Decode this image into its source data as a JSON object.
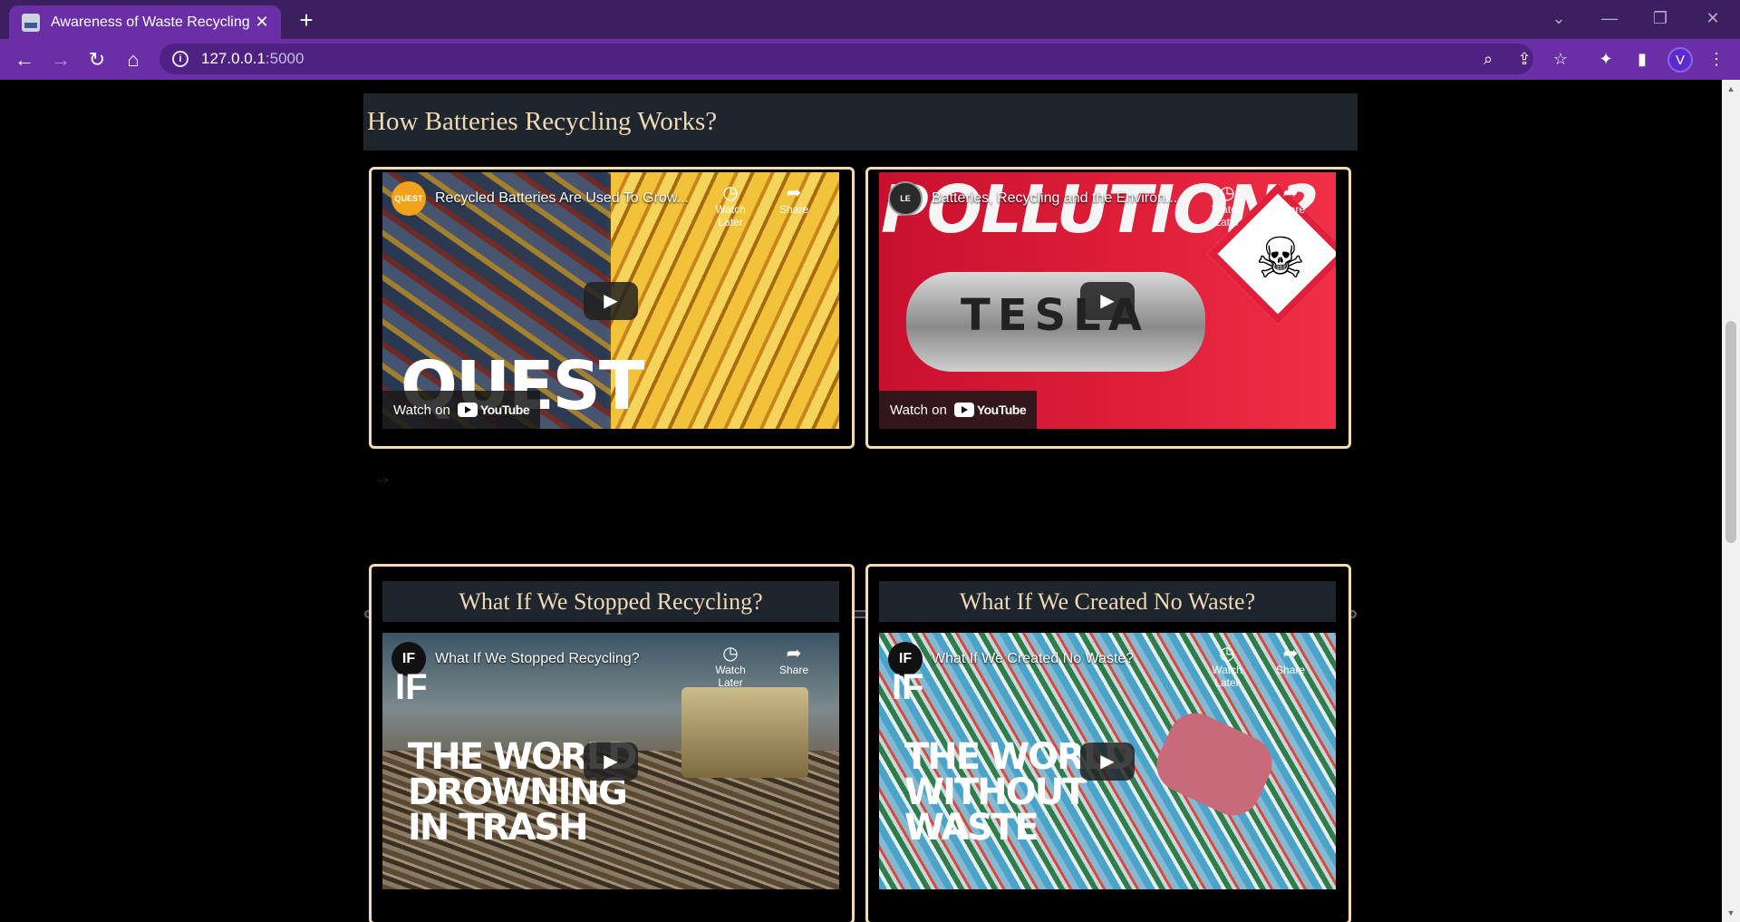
{
  "browser": {
    "tab_title": "Awareness of Waste Recycling",
    "tab_close": "✕",
    "new_tab": "+",
    "url_host": "127.0.0.1",
    "url_port": ":5000",
    "profile_initial": "V",
    "icons": {
      "back": "←",
      "forward": "→",
      "reload": "↻",
      "home": "⌂",
      "zoom": "⌕",
      "share": "⇪",
      "star": "☆",
      "extensions": "✦",
      "sidepanel": "▮",
      "menu": "⋮",
      "tab_search": "⌄",
      "minimize": "—",
      "restore": "❐",
      "close": "✕"
    }
  },
  "page": {
    "section_title": "How Batteries Recycling Works?",
    "comment_stub": "-->",
    "videos_top": [
      {
        "title": "Recycled Batteries Are Used To Grow...",
        "channel": "QUEST",
        "watch_later": "Watch Later",
        "share": "Share",
        "watch_on": "Watch on",
        "youtube": "YouTube",
        "overlay_text": "QUEST"
      },
      {
        "title": "Batteries, Recycling and the Environ...",
        "channel": "LE",
        "watch_later": "Watch Later",
        "share": "Share",
        "watch_on": "Watch on",
        "youtube": "YouTube",
        "overlay_text": "POLLUTION?",
        "overlay_text2": "TESLA"
      }
    ],
    "cards_bottom": [
      {
        "heading": "What If We Stopped Recycling?",
        "title": "What If We Stopped Recycling?",
        "channel": "IF",
        "watch_later": "Watch Later",
        "share": "Share",
        "overlay_lines": [
          "THE WORLD",
          "DROWNING",
          "IN TRASH"
        ]
      },
      {
        "heading": "What If We Created No Waste?",
        "title": "What If We Created No Waste?",
        "channel": "IF",
        "watch_later": "Watch Later",
        "share": "Share",
        "overlay_lines": [
          "THE WORLD",
          "WITHOUT",
          "WASTE"
        ]
      }
    ]
  }
}
